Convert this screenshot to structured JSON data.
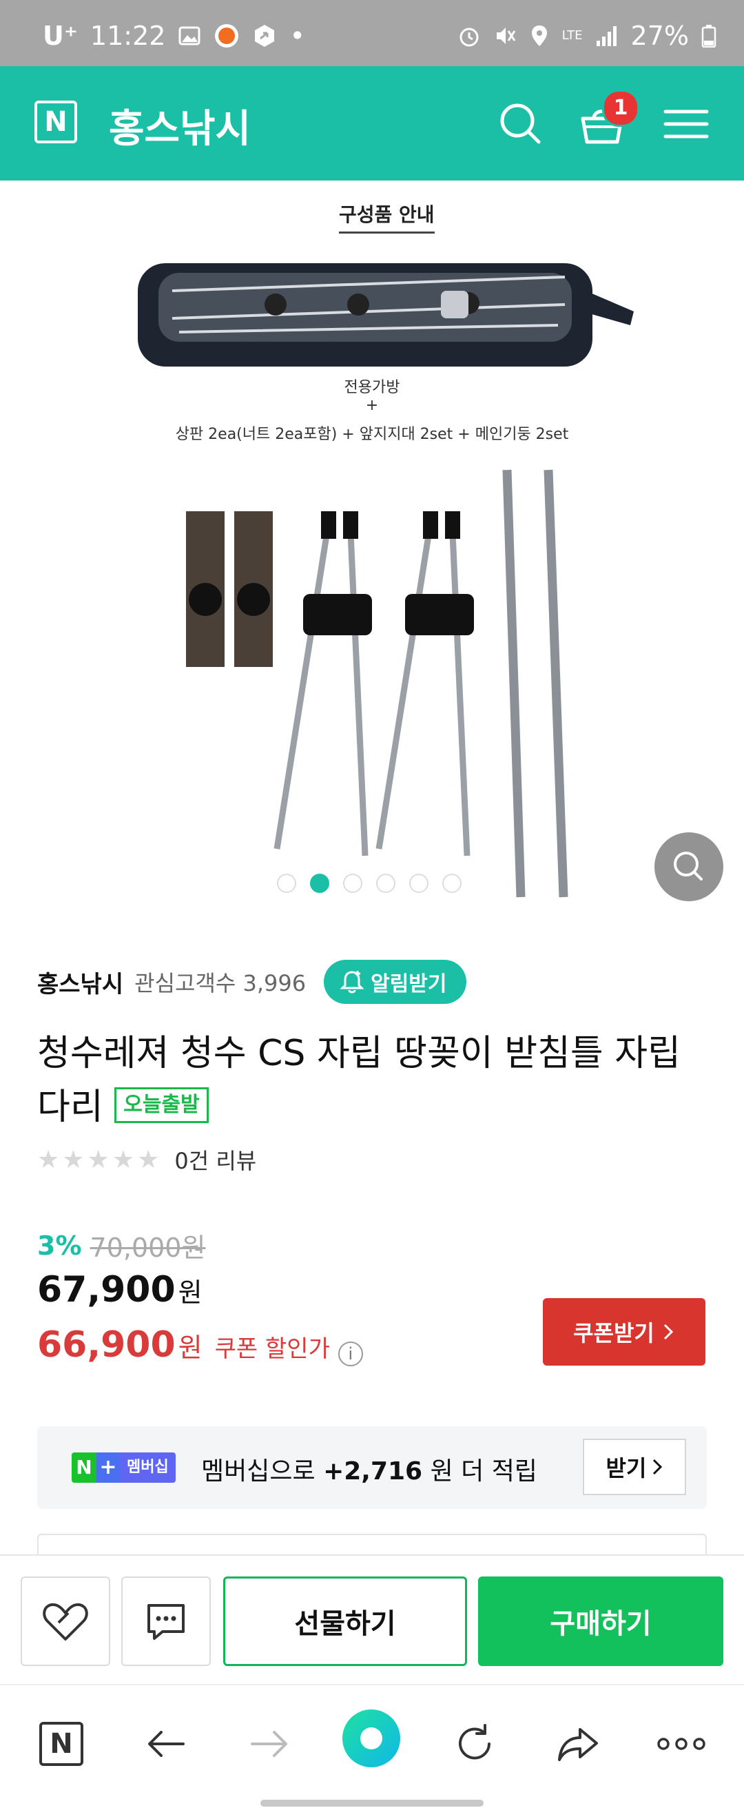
{
  "status_bar": {
    "carrier": "U⁺",
    "time": "11:22",
    "battery": "27%",
    "network": "LTE"
  },
  "header": {
    "logo": "N",
    "store_name": "홍스낚시",
    "cart_count": "1"
  },
  "product_image": {
    "caption_title": "구성품 안내",
    "caption_line1": "전용가방",
    "caption_plus": "+",
    "caption_line2": "상판 2ea(너트 2ea포함) + 앞지지대 2set + 메인기둥 2set",
    "slide_count": 6,
    "active_slide": 2
  },
  "seller": {
    "name": "홍스낚시",
    "fans_label": "관심고객수 3,996",
    "alert_button": "알림받기"
  },
  "product": {
    "title": "청수레져 청수 CS 자립 땅꽂이 받침틀 자립다리",
    "badge": "오늘출발",
    "stars": "★★★★★",
    "review_count": "0건 리뷰",
    "discount_rate": "3%",
    "original_price": "70,000원",
    "sale_price": "67,900",
    "coupon_price": "66,900",
    "currency": "원",
    "coupon_price_label": "쿠폰 할인가",
    "coupon_button": "쿠폰받기"
  },
  "membership": {
    "badge_n": "N",
    "badge_plus": "+",
    "badge_label": "멤버십",
    "text_prefix": "멤버십으로",
    "points": "+2,716",
    "text_suffix": "원 더 적립",
    "receive_button": "받기"
  },
  "purchase_bar": {
    "gift_button": "선물하기",
    "buy_button": "구매하기"
  },
  "browser_nav": {
    "logo": "N"
  },
  "colors": {
    "brand": "#1bbfa6",
    "buy": "#12c05c",
    "coupon": "#d9352f",
    "badge": "#e93434"
  }
}
